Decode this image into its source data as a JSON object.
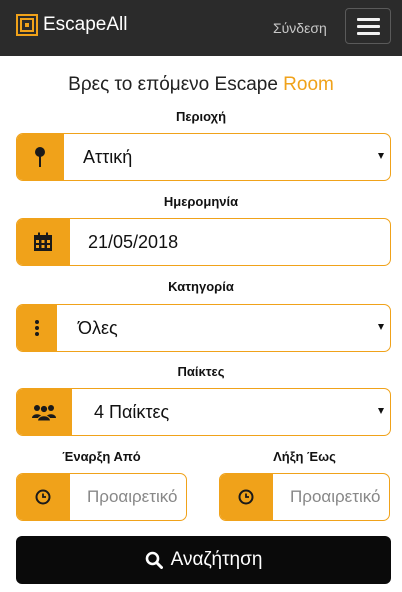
{
  "header": {
    "brand": "EscapeAll",
    "login_label": "Σύνδεση"
  },
  "search": {
    "title_main": "Βρες το επόμενο Escape ",
    "title_accent": "Room",
    "area": {
      "label": "Περιοχή",
      "value": "Αττική",
      "icon": "map-pin-icon"
    },
    "date": {
      "label": "Ημερομηνία",
      "value": "21/05/2018",
      "icon": "calendar-icon"
    },
    "category": {
      "label": "Κατηγορία",
      "value": "Όλες",
      "icon": "vertical-dots-icon"
    },
    "players": {
      "label": "Παίκτες",
      "value": "4 Παίκτες",
      "icon": "users-icon"
    },
    "start": {
      "label": "Έναρξη Από",
      "placeholder": "Προαιρετικό",
      "icon": "clock-icon"
    },
    "end": {
      "label": "Λήξη Έως",
      "placeholder": "Προαιρετικό",
      "icon": "clock-icon"
    },
    "submit_label": "Αναζήτηση"
  },
  "colors": {
    "accent": "#f0a21a",
    "navbar": "#2b2b2b",
    "button": "#0a0a0a"
  }
}
